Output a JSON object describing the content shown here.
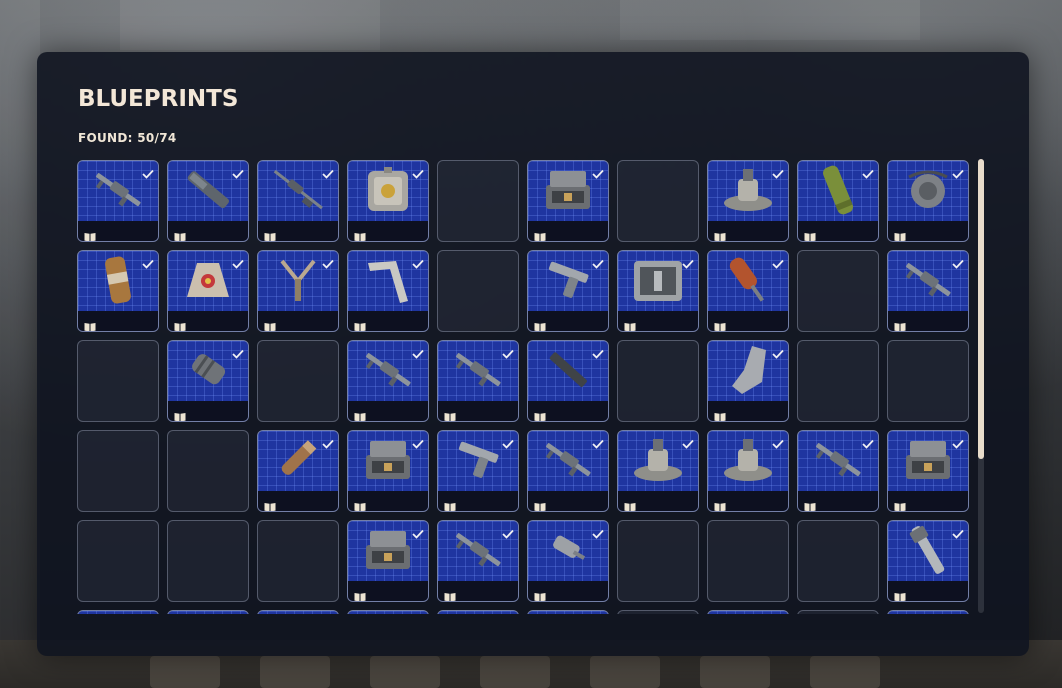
{
  "screen": {
    "title": "BLUEPRINTS",
    "found_label": "FOUND: 50/74",
    "found_count": 50,
    "total_count": 74,
    "scroll_position_fraction": 0.0,
    "scroll_visible_fraction": 0.66
  },
  "colors": {
    "blueprint_bg": "#1f35a0",
    "panel_bg": "#101420",
    "title": "#f3e7d7",
    "scroll_thumb": "#e8dccb"
  },
  "icons": {
    "found_mark": "checkmark-icon",
    "blueprint_mark": "open-book-icon"
  },
  "grid": {
    "rows": [
      [
        "rifle",
        "launcher",
        "sniper",
        "crate",
        null,
        "case",
        null,
        "turret",
        "tube",
        "mine"
      ],
      [
        "canister",
        "pouch",
        "slingshot",
        "stock",
        null,
        "pistol",
        "ammo-box",
        "rocket",
        null,
        "rifle"
      ],
      [
        null,
        "suppressor",
        null,
        "rifle",
        "rifle",
        "barrel",
        null,
        "shield",
        null,
        null
      ],
      [
        null,
        null,
        "shell",
        "case",
        "pistol",
        "rifle",
        "turret",
        "turret",
        "rifle",
        "case"
      ],
      [
        null,
        null,
        null,
        "case",
        "rifle",
        "grip",
        null,
        null,
        null,
        "rod"
      ],
      [
        "partial",
        "partial",
        "partial",
        "partial",
        "partial",
        "partial",
        null,
        "partial",
        null,
        "partial"
      ]
    ]
  }
}
